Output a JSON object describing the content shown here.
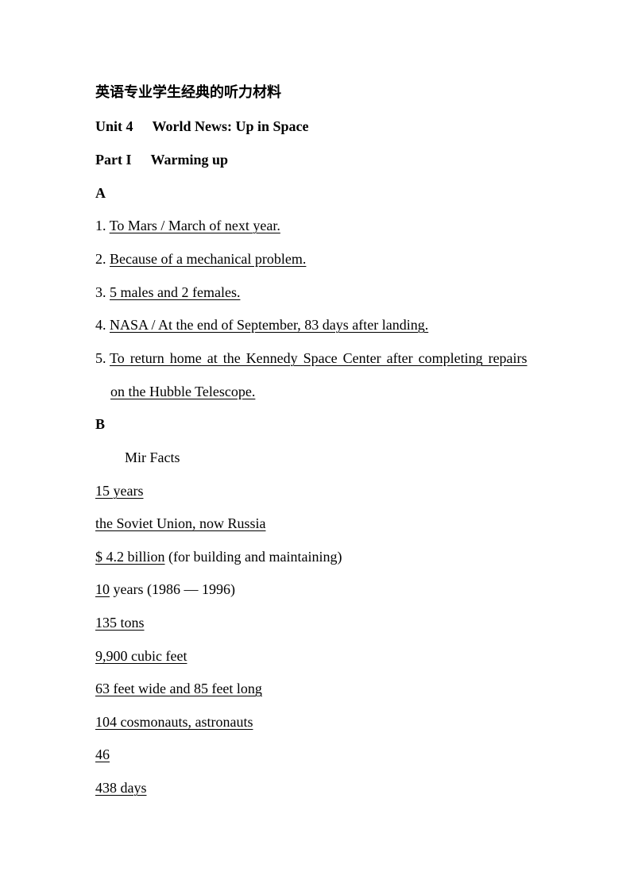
{
  "document": {
    "title": "英语专业学生经典的听力材料",
    "unit": {
      "label": "Unit 4",
      "title": "World News: Up in Space"
    },
    "part": {
      "label": "Part I",
      "title": "Warming up"
    },
    "section_a": {
      "label": "A",
      "items": [
        {
          "num": "1.",
          "answer": "To Mars / March of next year."
        },
        {
          "num": "2.",
          "answer": "Because of a mechanical problem."
        },
        {
          "num": "3.",
          "answer": "5 males and 2 females."
        },
        {
          "num": "4.",
          "answer": "NASA / At the end of September, 83 days after landing."
        },
        {
          "num": "5.",
          "answer_line1": "To return home at the Kennedy Space Center after completing repairs",
          "answer_line2": "on the Hubble Telescope."
        }
      ]
    },
    "section_b": {
      "label": "B",
      "heading": "Mir Facts",
      "facts": [
        {
          "answer": "15 years",
          "note": ""
        },
        {
          "answer": "the Soviet Union, now Russia",
          "note": ""
        },
        {
          "answer": "$ 4.2 billion",
          "note": " (for building and maintaining)"
        },
        {
          "answer": "10",
          "note": " years (1986 — 1996)"
        },
        {
          "answer": "135 tons",
          "note": ""
        },
        {
          "answer": "9,900 cubic feet",
          "note": ""
        },
        {
          "answer": "63 feet wide and 85 feet long",
          "note": ""
        },
        {
          "answer": "104 cosmonauts, astronauts",
          "note": ""
        },
        {
          "answer": "46",
          "note": ""
        },
        {
          "answer": "438 days",
          "note": ""
        }
      ]
    }
  }
}
